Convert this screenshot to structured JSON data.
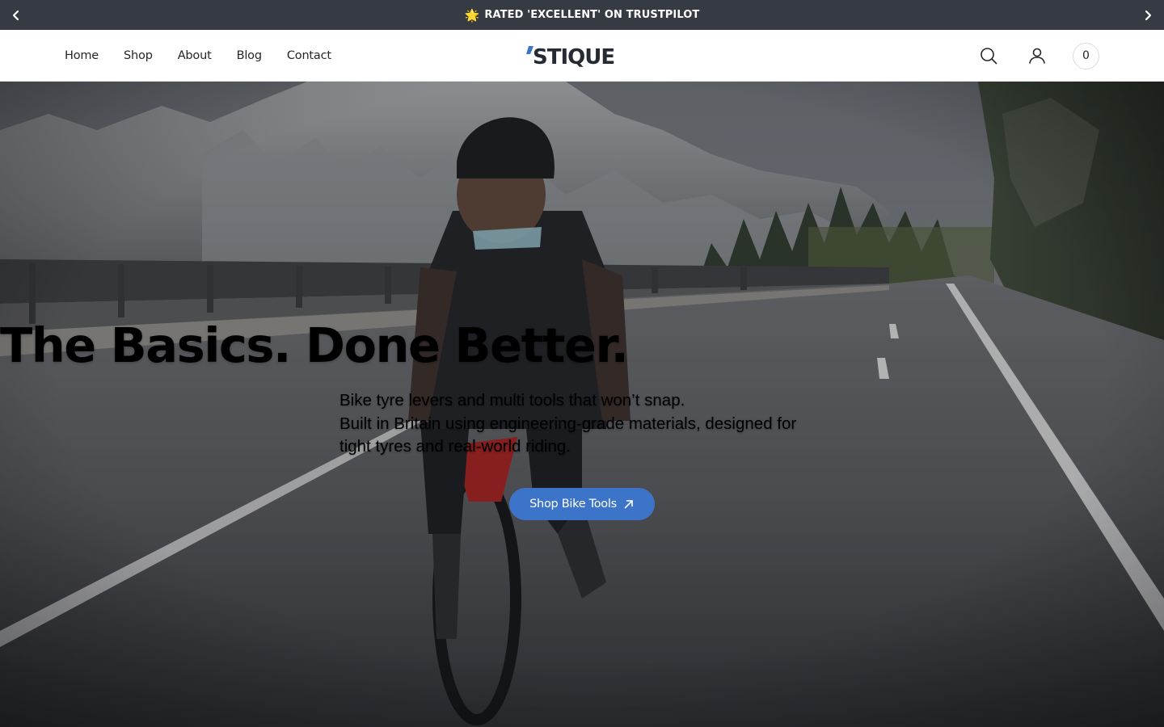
{
  "announcement": {
    "icon": "star-icon",
    "text": "RATED 'EXCELLENT' ON TRUSTPILOT",
    "background": "#363a42"
  },
  "nav": {
    "items": [
      {
        "label": "Home"
      },
      {
        "label": "Shop"
      },
      {
        "label": "About"
      },
      {
        "label": "Blog"
      },
      {
        "label": "Contact"
      }
    ]
  },
  "brand": {
    "name": "STIQUE",
    "accent": "#3b74c8"
  },
  "header_actions": {
    "search_icon": "search-icon",
    "account_icon": "user-icon",
    "cart_count": "0"
  },
  "hero": {
    "title": "The Basics. Done Better.",
    "subtitle_lines": [
      "Bike tyre levers and multi tools that won’t snap.",
      "Built in Britain using engineering-grade materials, designed for",
      "tight tyres and real-world riding."
    ],
    "cta_label": "Shop Bike Tools",
    "cta_icon": "arrow-up-right-icon",
    "cta_color": "#3b74c8"
  }
}
